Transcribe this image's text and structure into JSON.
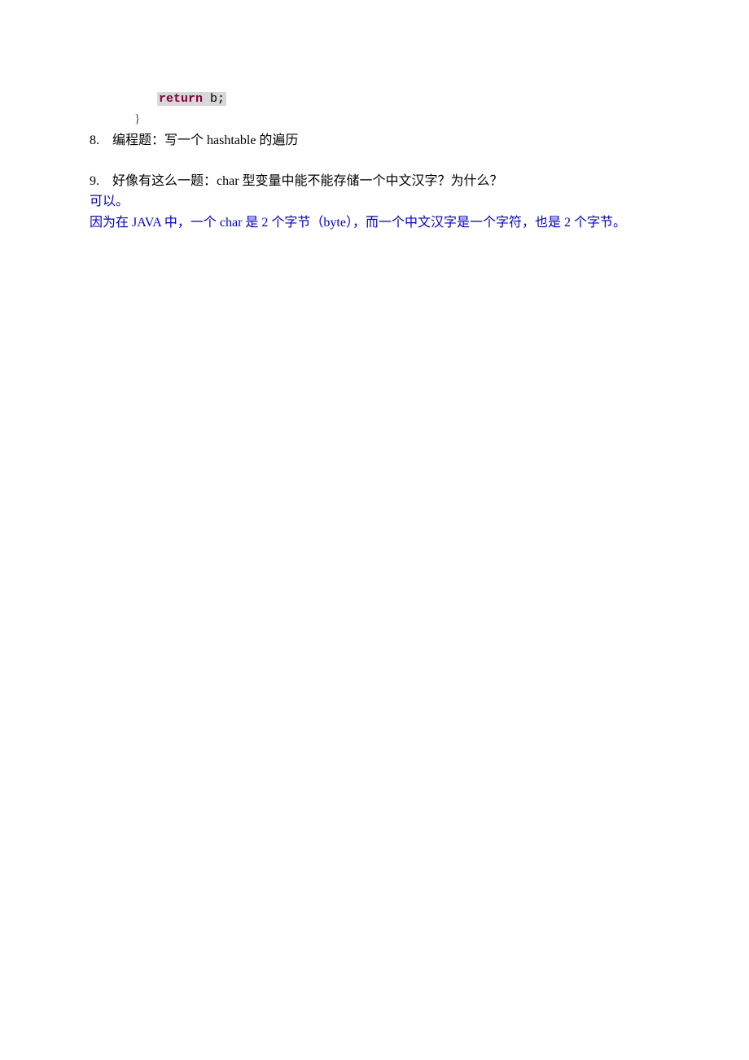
{
  "code": {
    "keyword": "return",
    "rest": " b;",
    "brace": "}"
  },
  "q8": {
    "num": "8.",
    "text": "编程题：写一个 hashtable 的遍历"
  },
  "q9": {
    "num": "9.",
    "text": "好像有这么一题：char 型变量中能不能存储一个中文汉字？为什么？",
    "ans1": "可以。",
    "ans2": "因为在 JAVA 中，一个 char 是 2 个字节（byte），而一个中文汉字是一个字符，也是 2 个字节。"
  }
}
